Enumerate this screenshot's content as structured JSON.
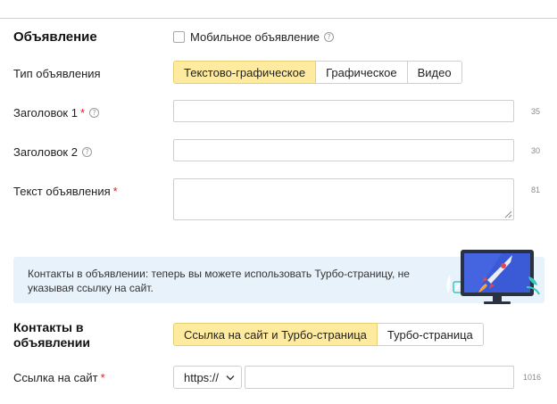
{
  "ad_section": {
    "title": "Объявление",
    "mobile_ad_label": "Мобильное объявление",
    "mobile_ad_checked": false
  },
  "ad_type": {
    "label": "Тип объявления",
    "options": [
      {
        "label": "Текстово-графическое",
        "active": true
      },
      {
        "label": "Графическое",
        "active": false
      },
      {
        "label": "Видео",
        "active": false
      }
    ]
  },
  "fields": {
    "title1": {
      "label": "Заголовок 1",
      "required_mark": "*",
      "value": "",
      "counter": "35"
    },
    "title2": {
      "label": "Заголовок 2",
      "value": "",
      "counter": "30"
    },
    "text": {
      "label": "Текст объявления",
      "required_mark": "*",
      "value": "",
      "counter": "81"
    }
  },
  "help_glyph": "?",
  "banner": {
    "text": "Контакты в объявлении: теперь вы можете использовать Турбо-страницу, не указывая ссылку на сайт."
  },
  "contacts": {
    "title": "Контакты в объявлении",
    "options": [
      {
        "label": "Ссылка на сайт и Турбо-страница",
        "active": true
      },
      {
        "label": "Турбо-страница",
        "active": false
      }
    ]
  },
  "site_link": {
    "label": "Ссылка на сайт",
    "required_mark": "*",
    "protocol": "https://",
    "value": "",
    "counter": "1016"
  },
  "colors": {
    "active_segment": "#ffeba0",
    "required": "#e02020",
    "banner_bg": "#e8f2fb"
  }
}
